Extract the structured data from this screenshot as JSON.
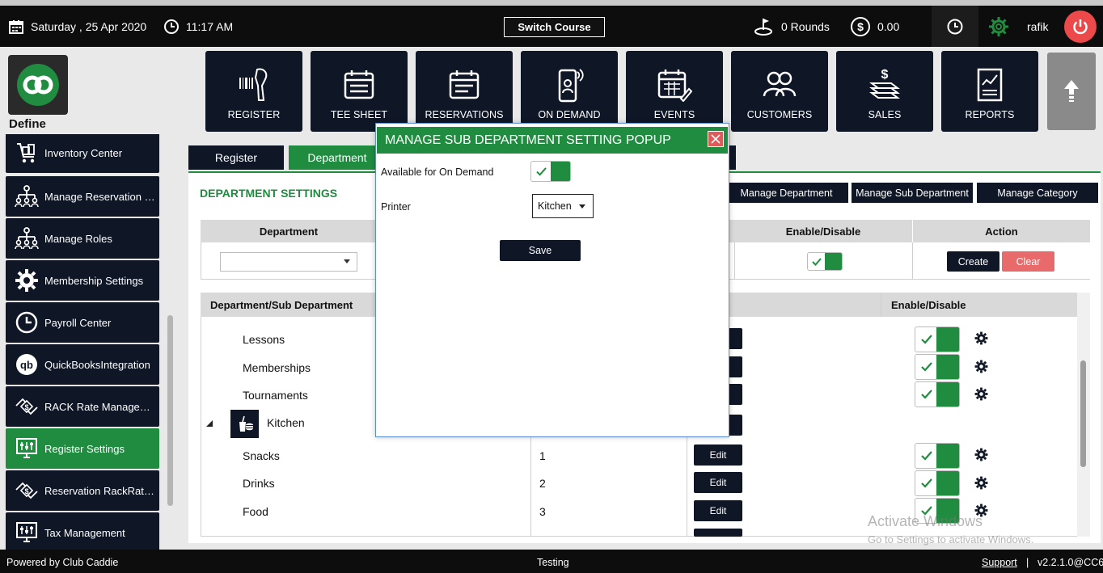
{
  "topbar": {
    "date": "Saturday ,  25 Apr 2020",
    "time": "11:17 AM",
    "switch_course": "Switch Course",
    "rounds": "0 Rounds",
    "amount": "0.00",
    "user": "rafik"
  },
  "brand": {
    "label": "Define"
  },
  "nav_tiles": [
    {
      "label": "REGISTER",
      "icon": "barcode-scanner-icon"
    },
    {
      "label": "TEE SHEET",
      "icon": "calendar-icon"
    },
    {
      "label": "RESERVATIONS",
      "icon": "calendar-list-icon"
    },
    {
      "label": "ON DEMAND",
      "icon": "mobile-icon"
    },
    {
      "label": "EVENTS",
      "icon": "calendar-edit-icon"
    },
    {
      "label": "CUSTOMERS",
      "icon": "users-icon"
    },
    {
      "label": "SALES",
      "icon": "money-icon"
    },
    {
      "label": "REPORTS",
      "icon": "report-icon"
    }
  ],
  "sidebar": {
    "items": [
      {
        "label": "Inventory Center",
        "icon": "cart-icon"
      },
      {
        "label": "Manage Reservation R...",
        "icon": "org-chart-icon"
      },
      {
        "label": "Manage Roles",
        "icon": "org-chart-icon"
      },
      {
        "label": "Membership Settings",
        "icon": "gear-icon"
      },
      {
        "label": "Payroll Center",
        "icon": "clock-icon"
      },
      {
        "label": "QuickBooksIntegration",
        "icon": "quickbooks-icon"
      },
      {
        "label": "RACK Rate Manageme...",
        "icon": "hand-money-icon"
      },
      {
        "label": "Register Settings",
        "icon": "sliders-monitor-icon",
        "active": true
      },
      {
        "label": "Reservation RackRate...",
        "icon": "hand-money-icon"
      },
      {
        "label": "Tax Management",
        "icon": "sliders-monitor-icon"
      }
    ]
  },
  "tabs": [
    {
      "label": "Register"
    },
    {
      "label": "Department",
      "active": true
    }
  ],
  "dept": {
    "title": "DEPARTMENT SETTINGS",
    "buttons": [
      "Manage Department",
      "Manage Sub Department",
      "Manage Category"
    ],
    "form_headers": {
      "department": "Department",
      "enable": "Enable/Disable",
      "action": "Action"
    },
    "create": "Create",
    "clear": "Clear",
    "table_headers": {
      "name": "Department/Sub Department",
      "enable": "Enable/Disable"
    },
    "rows": [
      {
        "name": "Lessons",
        "order": ""
      },
      {
        "name": "Memberships",
        "order": ""
      },
      {
        "name": "Tournaments",
        "order": ""
      },
      {
        "name": "Kitchen",
        "order": "",
        "parent": true
      },
      {
        "name": "Snacks",
        "order": "1",
        "edit": "Edit"
      },
      {
        "name": "Drinks",
        "order": "2",
        "edit": "Edit"
      },
      {
        "name": "Food",
        "order": "3",
        "edit": "Edit"
      }
    ]
  },
  "popup": {
    "title": "MANAGE SUB DEPARTMENT SETTING POPUP",
    "available_label": "Available for On Demand",
    "printer_label": "Printer",
    "printer_value": "Kitchen",
    "save": "Save"
  },
  "footer": {
    "powered": "Powered by Club Caddie",
    "env": "Testing",
    "support": "Support",
    "separator": "|",
    "version": "v2.2.1.0@CC6"
  },
  "watermark": {
    "line1": "Activate Windows",
    "line2": "Go to Settings to activate Windows."
  },
  "colors": {
    "accent": "#1f8c3f",
    "dark": "#0f1626",
    "danger": "#ec4a4a",
    "clear": "#e86a6a"
  }
}
